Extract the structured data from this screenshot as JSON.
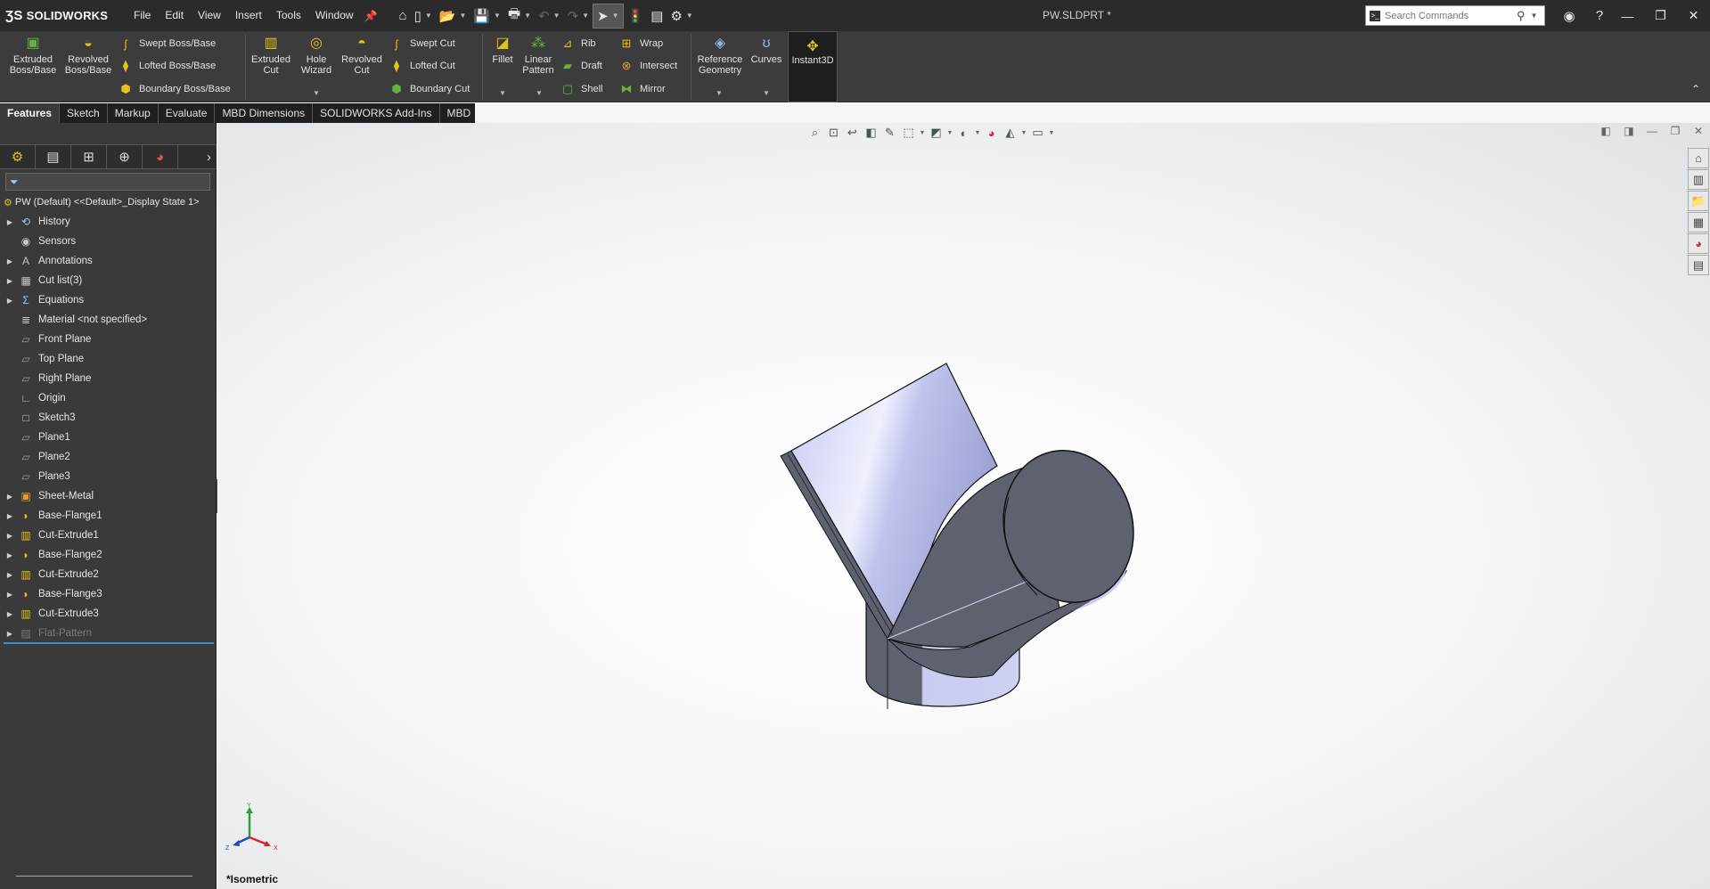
{
  "app": {
    "brand": "SOLIDWORKS",
    "title": "PW.SLDPRT *"
  },
  "menu": [
    "File",
    "Edit",
    "View",
    "Insert",
    "Tools",
    "Window"
  ],
  "search": {
    "placeholder": "Search Commands"
  },
  "ribbon": {
    "extruded_boss": "Extruded Boss/Base",
    "revolved_boss": "Revolved Boss/Base",
    "swept_boss": "Swept Boss/Base",
    "lofted_boss": "Lofted Boss/Base",
    "boundary_boss": "Boundary Boss/Base",
    "extruded_cut": "Extruded Cut",
    "hole_wizard": "Hole Wizard",
    "revolved_cut": "Revolved Cut",
    "swept_cut": "Swept Cut",
    "lofted_cut": "Lofted Cut",
    "boundary_cut": "Boundary Cut",
    "fillet": "Fillet",
    "linear_pattern": "Linear Pattern",
    "rib": "Rib",
    "draft": "Draft",
    "shell": "Shell",
    "wrap": "Wrap",
    "intersect": "Intersect",
    "mirror": "Mirror",
    "reference_geometry": "Reference Geometry",
    "curves": "Curves",
    "instant3d": "Instant3D"
  },
  "tabs": [
    "Features",
    "Sketch",
    "Markup",
    "Evaluate",
    "MBD Dimensions",
    "SOLIDWORKS Add-Ins",
    "MBD"
  ],
  "tree": {
    "root": "PW (Default) <<Default>_Display State 1>",
    "items": [
      {
        "label": "History",
        "icon": "history-icon",
        "expand": true
      },
      {
        "label": "Sensors",
        "icon": "sensor-icon",
        "expand": false
      },
      {
        "label": "Annotations",
        "icon": "annotation-icon",
        "expand": true
      },
      {
        "label": "Cut list(3)",
        "icon": "cutlist-icon",
        "expand": true
      },
      {
        "label": "Equations",
        "icon": "equation-icon",
        "expand": true
      },
      {
        "label": "Material <not specified>",
        "icon": "material-icon",
        "expand": false
      },
      {
        "label": "Front Plane",
        "icon": "plane-icon",
        "expand": false
      },
      {
        "label": "Top Plane",
        "icon": "plane-icon",
        "expand": false
      },
      {
        "label": "Right Plane",
        "icon": "plane-icon",
        "expand": false
      },
      {
        "label": "Origin",
        "icon": "origin-icon",
        "expand": false
      },
      {
        "label": "Sketch3",
        "icon": "sketch-icon",
        "expand": false
      },
      {
        "label": "Plane1",
        "icon": "plane-icon",
        "expand": false
      },
      {
        "label": "Plane2",
        "icon": "plane-icon",
        "expand": false
      },
      {
        "label": "Plane3",
        "icon": "plane-icon",
        "expand": false
      },
      {
        "label": "Sheet-Metal",
        "icon": "sheet-metal-icon",
        "expand": true
      },
      {
        "label": "Base-Flange1",
        "icon": "base-flange-icon",
        "expand": true
      },
      {
        "label": "Cut-Extrude1",
        "icon": "cut-extrude-icon",
        "expand": true
      },
      {
        "label": "Base-Flange2",
        "icon": "base-flange-icon",
        "expand": true
      },
      {
        "label": "Cut-Extrude2",
        "icon": "cut-extrude-icon",
        "expand": true
      },
      {
        "label": "Base-Flange3",
        "icon": "base-flange-icon",
        "expand": true
      },
      {
        "label": "Cut-Extrude3",
        "icon": "cut-extrude-icon",
        "expand": true
      },
      {
        "label": "Flat-Pattern",
        "icon": "flat-pattern-icon",
        "expand": true,
        "suppressed": true
      }
    ]
  },
  "viewport": {
    "view_name": "*Isometric",
    "triad": {
      "x": "X",
      "y": "Y",
      "z": "Z"
    }
  },
  "colors": {
    "model_light": "#c9cbef",
    "model_dark": "#5d6170",
    "titlebar": "#2b2b2b",
    "ribbon": "#3c3c3c",
    "panel": "#3a3a3a",
    "accent": "#3d8bd1"
  }
}
